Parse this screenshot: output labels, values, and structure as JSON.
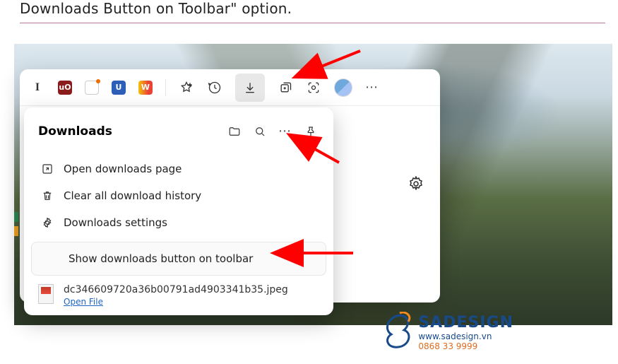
{
  "article": {
    "partial_heading": "Downloads Button on Toolbar\" option."
  },
  "browser": {
    "toolbar_icons": {
      "text_I": "I",
      "shield": "uO",
      "share": "↗",
      "bitwarden": "U",
      "w_ext": "W"
    },
    "downloads_button_active": true
  },
  "downloads_panel": {
    "title": "Downloads",
    "menu": {
      "open_page": "Open downloads page",
      "clear_history": "Clear all download history",
      "settings": "Downloads settings",
      "show_button": "Show downloads button on toolbar"
    },
    "entry": {
      "filename": "dc346609720a36b00791ad4903341b35.jpeg",
      "action": "Open File"
    }
  },
  "watermark": {
    "brand": "SADESIGN",
    "url": "www.sadesign.vn",
    "phone": "0868 33 9999"
  },
  "colors": {
    "arrow": "#ff0000",
    "link": "#1f65c0"
  }
}
